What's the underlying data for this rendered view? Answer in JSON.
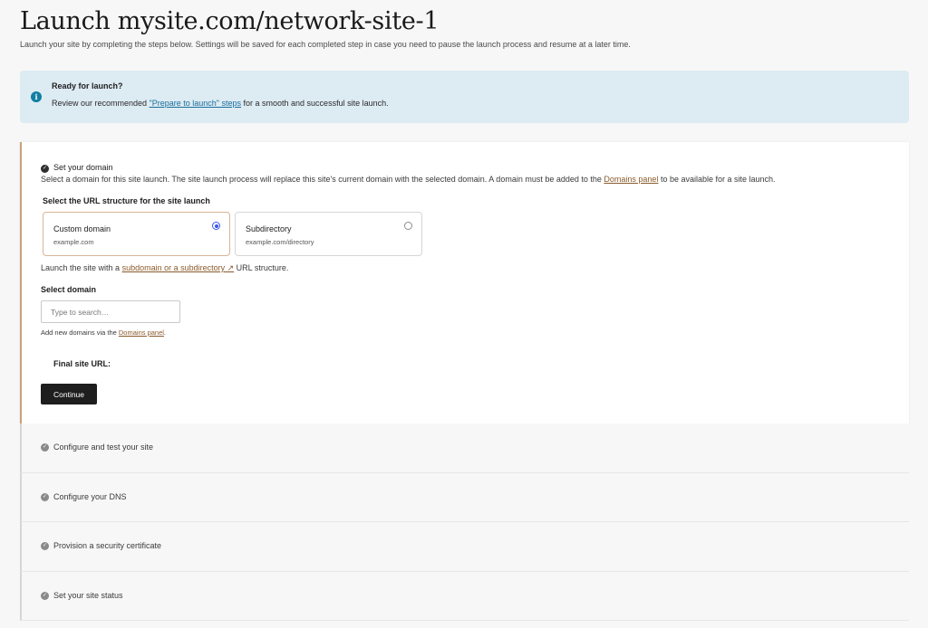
{
  "header": {
    "title": "Launch mysite.com/network-site-1",
    "subtitle": "Launch your site by completing the steps below. Settings will be saved for each completed step in case you need to pause the launch process and resume at a later time."
  },
  "notice": {
    "icon": "info-icon",
    "title": "Ready for launch?",
    "text_before": "Review our recommended ",
    "link": "\"Prepare to launch\" steps",
    "text_after": " for a smooth and successful site launch."
  },
  "active_step": {
    "icon": "check-circle-icon",
    "title": "Set your domain",
    "description_before": "Select a domain for this site launch. The site launch process will replace this site's current domain with the selected domain. A domain must be added to the ",
    "description_link": "Domains panel",
    "description_after": " to be available for a site launch.",
    "url_structure_label": "Select the URL structure for the site launch",
    "options": [
      {
        "title": "Custom domain",
        "subtitle": "example.com",
        "selected": true
      },
      {
        "title": "Subdirectory",
        "subtitle": "example.com/directory",
        "selected": false
      }
    ],
    "structure_help_before": "Launch the site with a ",
    "structure_help_link": "subdomain or a subdirectory ↗",
    "structure_help_after": " URL structure.",
    "select_domain_label": "Select domain",
    "search_placeholder": "Type to search…",
    "domains_help_before": "Add new domains via the ",
    "domains_help_link": "Domains panel",
    "domains_help_after": ".",
    "final_url_label": "Final site URL:",
    "continue_label": "Continue"
  },
  "collapsed_steps": [
    {
      "title": "Configure and test your site"
    },
    {
      "title": "Configure your DNS"
    },
    {
      "title": "Provision a security certificate"
    },
    {
      "title": "Set your site status"
    }
  ],
  "colors": {
    "accent_border": "#c8a27a",
    "link_brown": "#8a5a2b",
    "notice_bg": "#ddebf3",
    "radio_blue": "#3858e9",
    "button_bg": "#1e1e1e"
  }
}
